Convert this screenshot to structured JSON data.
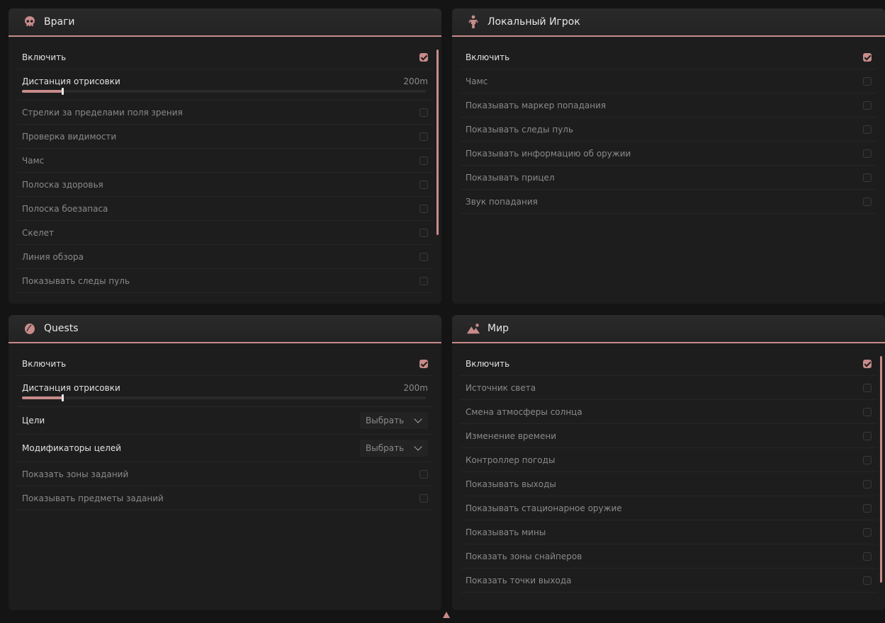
{
  "panels": {
    "enemies": {
      "title": "Враги",
      "icon": "skull-icon",
      "enable_label": "Включить",
      "slider": {
        "label": "Дистанция отрисовки",
        "value_text": "200m",
        "level": 0.1
      },
      "items": [
        "Стрелки за пределами поля зрения",
        "Проверка видимости",
        "Чамс",
        "Полоска здоровья",
        "Полоска боезапаса",
        "Скелет",
        "Линия обзора",
        "Показывать следы пуль"
      ]
    },
    "local_player": {
      "title": "Локальный Игрок",
      "icon": "person-icon",
      "enable_label": "Включить",
      "items": [
        "Чамс",
        "Показывать маркер попадания",
        "Показывать следы пуль",
        "Показывать информацию об оружии",
        "Показывать прицел",
        "Звук попадания"
      ]
    },
    "quests": {
      "title": "Quests",
      "icon": "egg-icon",
      "enable_label": "Включить",
      "slider": {
        "label": "Дистанция отрисовки",
        "value_text": "200m",
        "level": 0.1
      },
      "combos": [
        {
          "label": "Цели",
          "value": "Выбрать"
        },
        {
          "label": "Модификаторы целей",
          "value": "Выбрать"
        }
      ],
      "items": [
        "Показать зоны заданий",
        "Показывать предметы заданий"
      ]
    },
    "world": {
      "title": "Мир",
      "icon": "landscape-icon",
      "enable_label": "Включить",
      "items": [
        "Источник света",
        "Смена атмосферы солнца",
        "Изменение времени",
        "Контроллер погоды",
        "Показывать выходы",
        "Показывать стационарное оружие",
        "Показывать мины",
        "Показать зоны снайперов",
        "Показать точки выхода"
      ]
    }
  },
  "colors": {
    "accent": "#c88b8b",
    "panel": "#1d1d1d",
    "background": "#141414"
  }
}
